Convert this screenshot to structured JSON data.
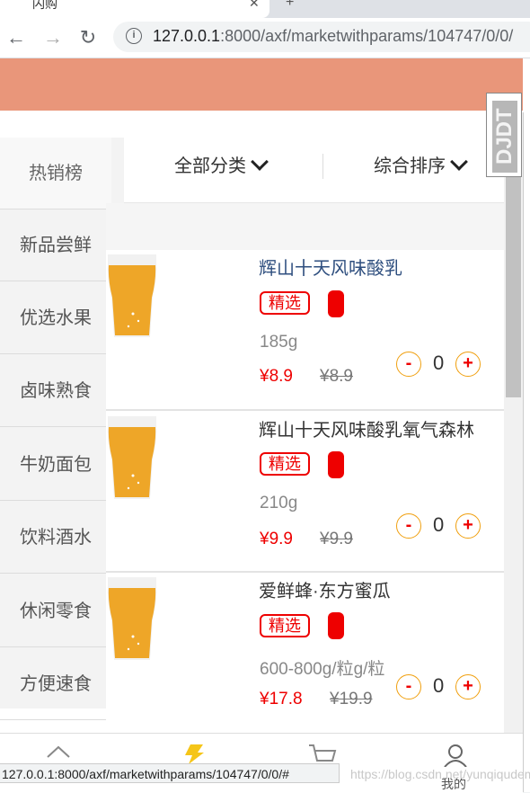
{
  "browser": {
    "tab_title": "闪购",
    "url_host": "127.0.0.1",
    "url_rest": ":8000/axf/marketwithparams/104747/0/0/"
  },
  "sidebar": {
    "items": [
      {
        "label": "热销榜"
      },
      {
        "label": "新品尝鲜"
      },
      {
        "label": "优选水果"
      },
      {
        "label": "卤味熟食"
      },
      {
        "label": "牛奶面包"
      },
      {
        "label": "饮料酒水"
      },
      {
        "label": "休闲零食"
      },
      {
        "label": "方便速食"
      }
    ]
  },
  "filters": {
    "category": "全部分类",
    "sort": "综合排序"
  },
  "products": [
    {
      "name": "辉山十天风味酸乳",
      "tag": "精选",
      "spec": "185g",
      "price": "¥8.9",
      "old_price": "¥8.9",
      "qty": "0"
    },
    {
      "name": "辉山十天风味酸乳氧气森林",
      "tag": "精选",
      "spec": "210g",
      "price": "¥9.9",
      "old_price": "¥9.9",
      "qty": "0"
    },
    {
      "name": "爱鲜蜂·东方蜜瓜",
      "tag": "精选",
      "spec": "600-800g/粒g/粒",
      "price": "¥17.8",
      "old_price": "¥19.9",
      "qty": "0"
    }
  ],
  "qty_controls": {
    "minus": "-",
    "plus": "+"
  },
  "status_bar": "127.0.0.1:8000/axf/marketwithparams/104747/0/0/#",
  "watermark": "https://blog.csdn.net/yunqiqudeming",
  "bottom_nav": {
    "mine_label": "我的"
  },
  "extension_badge": "DJDT",
  "colors": {
    "header": "#e9967a",
    "accent_red": "#ee0000",
    "qty_border": "#f0a010"
  }
}
